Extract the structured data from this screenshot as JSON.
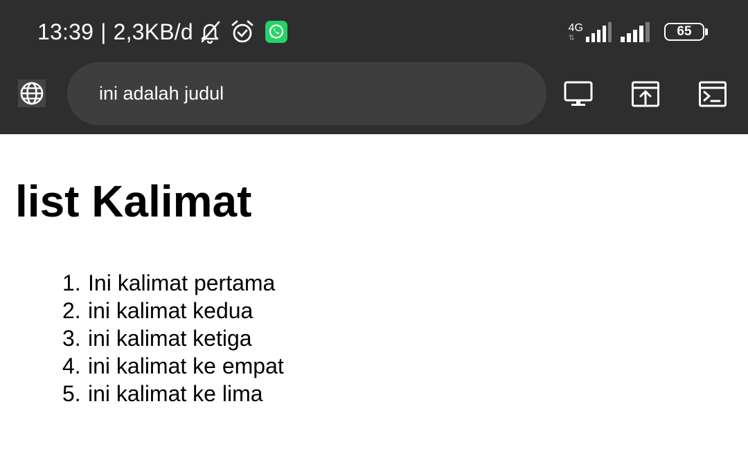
{
  "status_bar": {
    "time": "13:39",
    "separator": "|",
    "data_speed": "2,3KB/d",
    "network_type": "4G",
    "battery_level": "65",
    "icons": [
      "bell-off-icon",
      "alarm-icon",
      "whatsapp-icon",
      "signal-icon",
      "battery-icon"
    ]
  },
  "toolbar": {
    "address": "ini adalah judul",
    "buttons": [
      "globe-icon",
      "desktop-icon",
      "open-external-icon",
      "terminal-icon"
    ]
  },
  "page": {
    "title": "list Kalimat",
    "items": [
      {
        "number": "1.",
        "text": "Ini kalimat pertama"
      },
      {
        "number": "2.",
        "text": "ini kalimat kedua"
      },
      {
        "number": "3.",
        "text": "ini kalimat ketiga"
      },
      {
        "number": "4.",
        "text": "ini kalimat ke empat"
      },
      {
        "number": "5.",
        "text": "ini kalimat ke lima"
      }
    ]
  },
  "colors": {
    "bar_background": "#2e2e2e",
    "address_background": "#3e3e3e",
    "whatsapp_green": "#25d366"
  }
}
